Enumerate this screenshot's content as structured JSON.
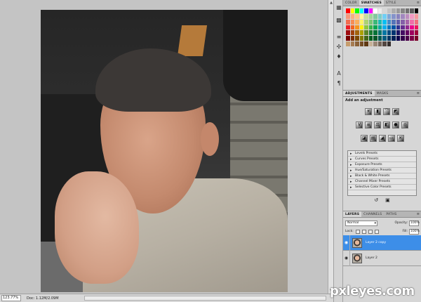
{
  "swatches_panel": {
    "tabs": [
      {
        "label": "COLOR",
        "active": false
      },
      {
        "label": "SWATCHES",
        "active": true
      },
      {
        "label": "STYLE",
        "active": false
      }
    ],
    "colors": [
      "#ff0000",
      "#ffff00",
      "#00ff00",
      "#00ffff",
      "#0000ff",
      "#ff00ff",
      "#ffffff",
      "#ebebeb",
      "#d6d6d6",
      "#c2c2c2",
      "#adadad",
      "#999999",
      "#858585",
      "#707070",
      "#5c5c5c",
      "#000000",
      "#f7977a",
      "#f9ad81",
      "#fdc68a",
      "#fff79a",
      "#c4df9b",
      "#a2d39c",
      "#82ca9d",
      "#7bcdc8",
      "#6ecff6",
      "#7ea7d8",
      "#8493ca",
      "#8882be",
      "#a187be",
      "#bc8dbf",
      "#f49ac2",
      "#f6989d",
      "#f26c4f",
      "#f68e55",
      "#fbaf5c",
      "#fff467",
      "#acd372",
      "#7cc576",
      "#3bb878",
      "#1abbb4",
      "#00bff3",
      "#438cca",
      "#5574b9",
      "#605ca8",
      "#855fa8",
      "#a763a8",
      "#f06ea9",
      "#f26d7d",
      "#ed1c24",
      "#f26522",
      "#f7941d",
      "#fff200",
      "#8dc73f",
      "#39b54a",
      "#00a651",
      "#00a99d",
      "#00aeef",
      "#0072bc",
      "#0054a6",
      "#2e3192",
      "#662d91",
      "#92278f",
      "#ec008c",
      "#ed145b",
      "#9e0b0f",
      "#a0410d",
      "#a3620a",
      "#aba000",
      "#598527",
      "#1a7b30",
      "#007236",
      "#00746b",
      "#0076a3",
      "#004b80",
      "#003471",
      "#1b1464",
      "#440e62",
      "#630460",
      "#9e005d",
      "#9e0039",
      "#790000",
      "#7b2e00",
      "#7d4900",
      "#827b00",
      "#406618",
      "#005e20",
      "#005826",
      "#005952",
      "#005b7f",
      "#003663",
      "#002157",
      "#0d004c",
      "#32004b",
      "#4b0049",
      "#7b0046",
      "#7a0026",
      "#c69c6d",
      "#a67c52",
      "#8c6239",
      "#754c24",
      "#603913",
      "#c7b299",
      "#998675",
      "#736357",
      "#534741",
      "#362f2d"
    ]
  },
  "adjustments_panel": {
    "tabs": [
      {
        "label": "ADJUSTMENTS",
        "active": true
      },
      {
        "label": "MASKS",
        "active": false
      }
    ],
    "title": "Add an adjustment",
    "presets": [
      "Levels Presets",
      "Curves Presets",
      "Exposure Presets",
      "Hue/Saturation Presets",
      "Black & White Presets",
      "Channel Mixer Presets",
      "Selective Color Presets"
    ]
  },
  "layers_panel": {
    "tabs": [
      {
        "label": "LAYERS",
        "active": true
      },
      {
        "label": "CHANNELS",
        "active": false
      },
      {
        "label": "PATHS",
        "active": false
      }
    ],
    "blend_mode": "Normal",
    "opacity_label": "Opacity:",
    "opacity_value": "100%",
    "lock_label": "Lock:",
    "fill_label": "Fill:",
    "fill_value": "100%",
    "layers": [
      {
        "name": "Layer 2 copy",
        "selected": true
      },
      {
        "name": "Layer 2",
        "selected": false
      }
    ]
  },
  "status_bar": {
    "zoom": "123.77%",
    "doc_info": "Doc: 1.12M/2.09M"
  },
  "watermark": "pxleyes.com"
}
